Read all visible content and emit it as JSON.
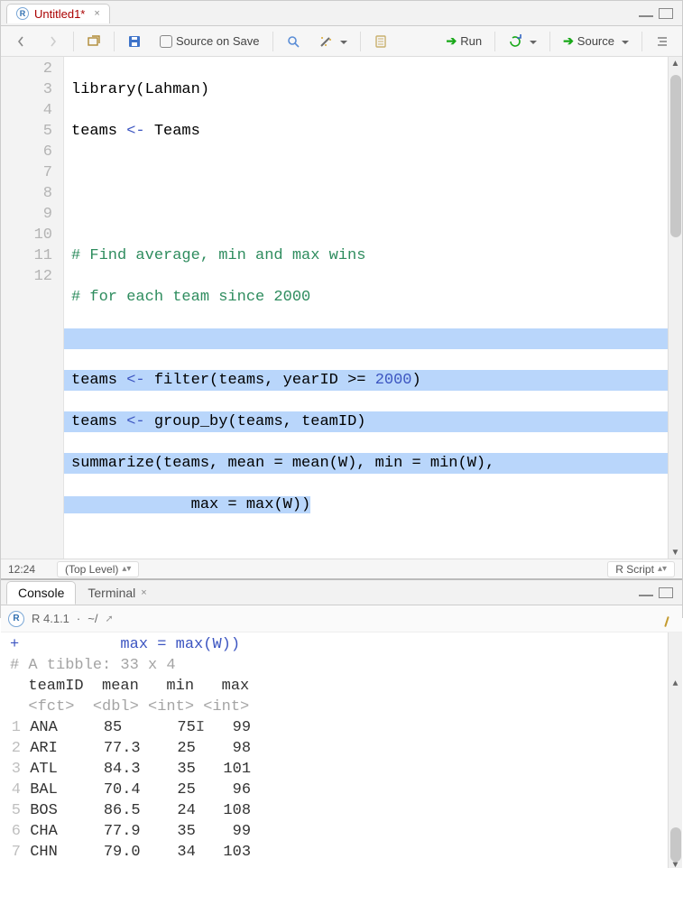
{
  "tab": {
    "title": "Untitled1*"
  },
  "toolbar": {
    "source_on_save": "Source on Save",
    "run": "Run",
    "source": "Source"
  },
  "code": {
    "lines": {
      "2": "library(Lahman)",
      "3": "teams <- Teams",
      "4": "",
      "5": "",
      "6": "# Find average, min and max wins",
      "7": "# for each team since 2000",
      "8": "",
      "9": "teams <- filter(teams, yearID >= 2000)",
      "10": "teams <- group_by(teams, teamID)",
      "11": "summarize(teams, mean = mean(W), min = min(W),",
      "12_a": "             max = max(W))",
      "12_b": ""
    }
  },
  "status": {
    "pos": "12:24",
    "scope": "(Top Level)",
    "lang": "R Script"
  },
  "console_tabs": {
    "console": "Console",
    "terminal": "Terminal"
  },
  "console_meta": {
    "version": "R 4.1.1",
    "path": "~/"
  },
  "console": {
    "echo_prefix": "+",
    "echo_text": "           max = max(W))",
    "tibble_meta": "# A tibble: 33 x 4",
    "header": "  teamID  mean   min   max",
    "types": "  <fct>  <dbl> <int> <int>",
    "rows": [
      {
        "n": "1",
        "team": "ANA",
        "mean": "85  ",
        "min": "75",
        "max": " 99"
      },
      {
        "n": "2",
        "team": "ARI",
        "mean": "77.3",
        "min": "25",
        "max": " 98"
      },
      {
        "n": "3",
        "team": "ATL",
        "mean": "84.3",
        "min": "35",
        "max": "101"
      },
      {
        "n": "4",
        "team": "BAL",
        "mean": "70.4",
        "min": "25",
        "max": " 96"
      },
      {
        "n": "5",
        "team": "BOS",
        "mean": "86.5",
        "min": "24",
        "max": "108"
      },
      {
        "n": "6",
        "team": "CHA",
        "mean": "77.9",
        "min": "35",
        "max": " 99"
      },
      {
        "n": "7",
        "team": "CHN",
        "mean": "79.0",
        "min": "34",
        "max": "103"
      }
    ]
  },
  "chart_data": {
    "type": "table",
    "title": "A tibble: 33 x 4",
    "columns": [
      "teamID",
      "mean",
      "min",
      "max"
    ],
    "column_types": [
      "<fct>",
      "<dbl>",
      "<int>",
      "<int>"
    ],
    "rows": [
      [
        "ANA",
        85,
        75,
        99
      ],
      [
        "ARI",
        77.3,
        25,
        98
      ],
      [
        "ATL",
        84.3,
        35,
        101
      ],
      [
        "BAL",
        70.4,
        25,
        96
      ],
      [
        "BOS",
        86.5,
        24,
        108
      ],
      [
        "CHA",
        77.9,
        35,
        99
      ],
      [
        "CHN",
        79.0,
        34,
        103
      ]
    ]
  }
}
